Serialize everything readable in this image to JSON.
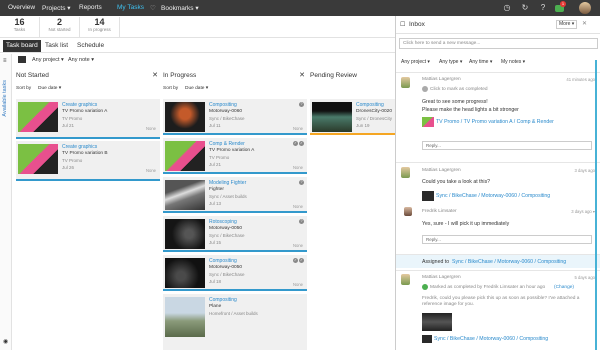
{
  "topbar": {
    "nav": [
      "Overview",
      "Projects ▾",
      "Reports",
      "My Tasks",
      "Bookmarks ▾"
    ],
    "badge": "1"
  },
  "stats": [
    {
      "n": "16",
      "l": "Tasks"
    },
    {
      "n": "2",
      "l": "Not started"
    },
    {
      "n": "14",
      "l": "In progress"
    }
  ],
  "tabs": [
    "Task board",
    "Task list",
    "Schedule"
  ],
  "filters": {
    "project": "Any project ▾",
    "note": "Any note ▾"
  },
  "sidebar_label": "Available tasks",
  "columns": [
    {
      "title": "Not Started",
      "sort": "Sort by",
      "sortval": "Due date ▾",
      "cards": [
        {
          "t1": "Create graphics",
          "t2": "TV Promo variation A",
          "t3": "TV Promo",
          "t4": "Jul 21",
          "nm": "None",
          "thumb": "tv"
        },
        {
          "t1": "Create graphics",
          "t2": "TV Promo variation B",
          "t3": "TV Promo",
          "t4": "Jul 26",
          "nm": "None",
          "thumb": "tv"
        }
      ]
    },
    {
      "title": "In Progress",
      "sort": "Sort by",
      "sortval": "Due date ▾",
      "cards": [
        {
          "t1": "Compositing",
          "t2": "Motorway-0060",
          "t3": "Sync / BikeChase",
          "t4": "Jul 11",
          "nm": "None",
          "thumb": "bike"
        },
        {
          "t1": "Comp & Render",
          "t2": "TV Promo variation A",
          "t3": "TV Promo",
          "t4": "Jul 21",
          "nm": "None",
          "thumb": "tv"
        },
        {
          "t1": "Modeling Fighter",
          "t2": "Fighter",
          "t3": "Sync / Asset builds",
          "t4": "Jul 13",
          "nm": "None",
          "thumb": "jet"
        },
        {
          "t1": "Rotoscoping",
          "t2": "Motorway-0050",
          "t3": "Sync / BikeChase",
          "t4": "Jul 15",
          "nm": "None",
          "thumb": "dark"
        },
        {
          "t1": "Compositing",
          "t2": "Motorway-0050",
          "t3": "Sync / BikeChase",
          "t4": "Jul 18",
          "nm": "None",
          "thumb": "dark"
        },
        {
          "t1": "Compositing",
          "t2": "Plane",
          "t3": "Homefront / Asset builds",
          "t4": "",
          "nm": "",
          "thumb": "sky"
        }
      ]
    },
    {
      "title": "Pending Review",
      "sort": "",
      "sortval": "",
      "cards": [
        {
          "t1": "Compositing",
          "t2": "DronesCity-0020",
          "t3": "Sync / DronesCity",
          "t4": "Jun 19",
          "nm": "",
          "thumb": "city"
        }
      ]
    }
  ],
  "inbox": {
    "title": "Inbox",
    "more": "More ▾",
    "composer": "Click here to send a new message...",
    "filters": [
      "Any project ▾",
      "Any type ▾",
      "Any time ▾",
      "My notes ▾"
    ],
    "m1": {
      "name": "Mattias Lagergren",
      "time": "41 minutes ago",
      "check": "Click to mark as completed",
      "l1": "Great to see some progress!",
      "l2": "Please make the head lights a bit stronger",
      "link": "TV Promo / TV Promo variation A / Comp & Render",
      "reply": "Reply..."
    },
    "m2": {
      "name": "Mattias Lagergren",
      "time": "3 days ago",
      "l1": "Could you take a look at this?",
      "link": "Sync / BikeChase / Motorway-0060 / Compositing"
    },
    "m3": {
      "name": "Fredrik Limsater",
      "time": "3 days ago ▾",
      "l1": "Yes, sure - I will pick it up immediately",
      "reply": "Reply..."
    },
    "assigned": {
      "pre": "Assigned to",
      "link": "Sync / BikeChase / Motorway-0060 / Compositing"
    },
    "m4": {
      "name": "Mattias Lagergren",
      "time": "5 days ago",
      "l1": "Marked as completed by Fredrik Limsater an hour ago",
      "change": "(Change)",
      "l2": "Fredrik, could you please pick this up as soon as possible? I've attached a reference image for you.",
      "link": "Sync / BikeChase / Motorway-0060 / Compositing"
    }
  }
}
